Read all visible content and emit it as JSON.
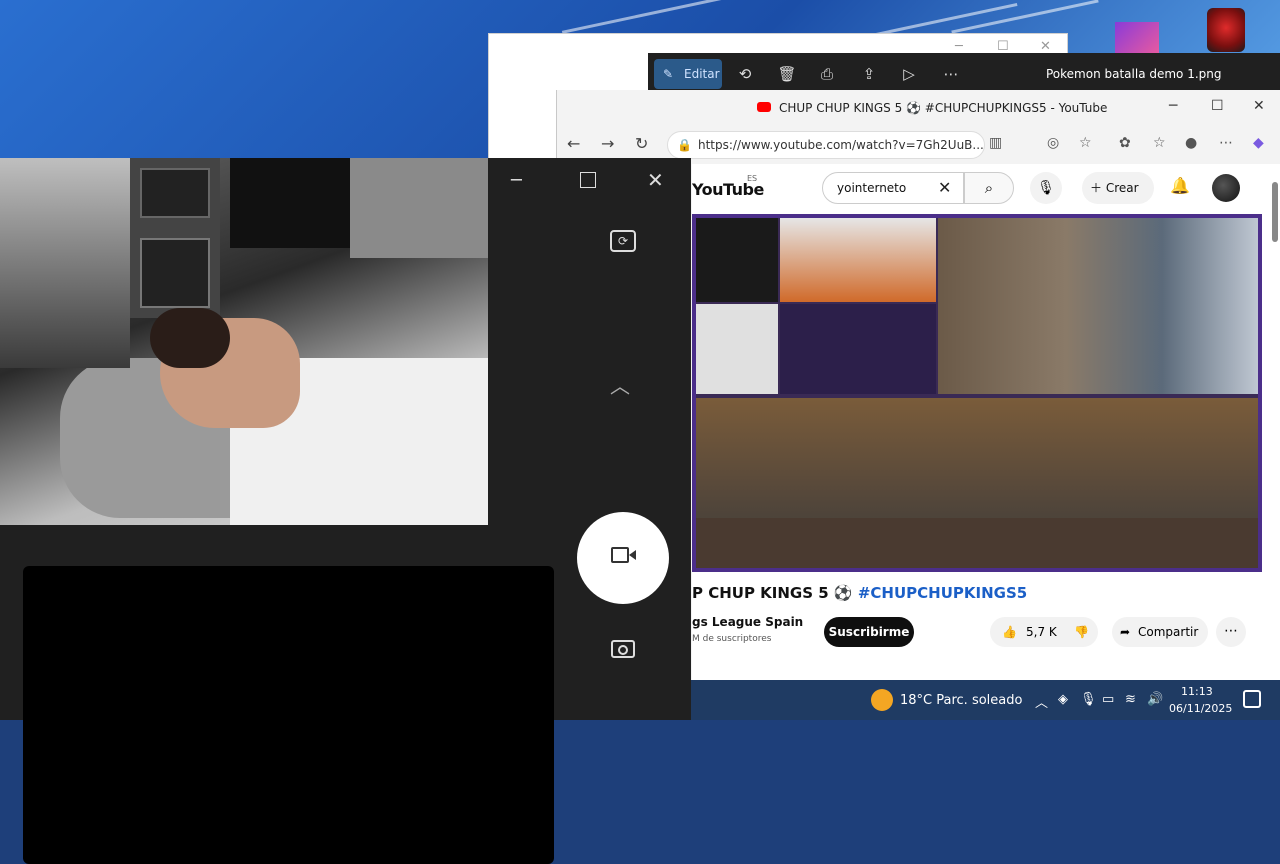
{
  "photos_viewer": {
    "edit_label": "Editar",
    "file_title": "Pokemon batalla demo 1.png"
  },
  "browser": {
    "tab_title": "CHUP CHUP KINGS 5 ⚽ #CHUPCHUPKINGS5 - YouTube",
    "url": "https://www.youtube.com/watch?v=7Gh2UuB...",
    "win_minimize": "─",
    "win_maximize": "☐",
    "win_close": "✕"
  },
  "youtube": {
    "logo": "YouTube",
    "region": "ES",
    "search_value": "yointerneto",
    "create_label": "Crear",
    "video_title": "P CHUP KINGS 5 ⚽",
    "video_hashtag": "#CHUPCHUPKINGS5",
    "channel_name": "gs League Spain",
    "subscribers": "M de suscriptores",
    "subscribe_label": "Suscribirme",
    "likes": "5,7 K",
    "share_label": "Compartir"
  },
  "taskbar": {
    "weather": "18°C  Parc. soleado",
    "time": "11:13",
    "date": "06/11/2025"
  },
  "colors": {
    "accent": "#2b5a8a",
    "youtube_red": "#ff0000",
    "hashtag": "#1b5fc7",
    "video_border": "#4b2e8a"
  }
}
